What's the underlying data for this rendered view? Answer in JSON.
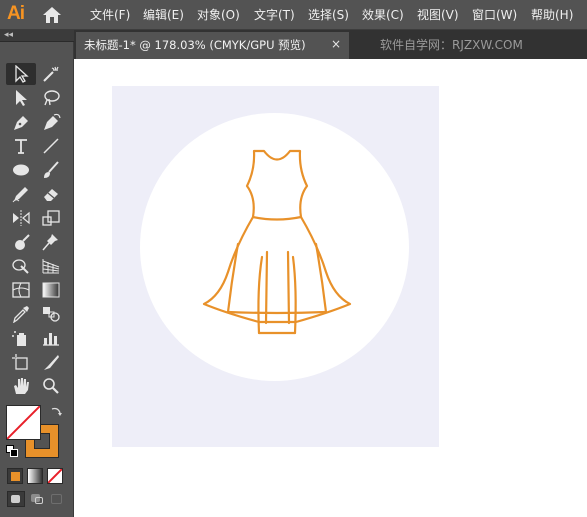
{
  "app": {
    "logo": "Ai",
    "home_icon": "home-icon"
  },
  "menu": {
    "items": [
      "文件(F)",
      "编辑(E)",
      "对象(O)",
      "文字(T)",
      "选择(S)",
      "效果(C)",
      "视图(V)",
      "窗口(W)",
      "帮助(H)"
    ]
  },
  "tabs": {
    "collapse": "◂◂",
    "active_title": "未标题-1* @ 178.03% (CMYK/GPU 预览)",
    "close": "×",
    "watermark": "软件自学网：RJZXW.COM"
  },
  "colors": {
    "accent": "#f79422",
    "dress_stroke": "#e8912a",
    "fill_swatch": "#ffffff",
    "stroke_swatch": "#e8912a",
    "artboard": "#eeeef8",
    "chrome": "#535353"
  },
  "tools": [
    "selection-tool",
    "magic-wand-tool",
    "direct-selection-tool",
    "lasso-tool",
    "pen-tool",
    "curvature-tool",
    "type-tool",
    "line-segment-tool",
    "ellipse-tool",
    "paintbrush-tool",
    "shaper-tool",
    "eraser-tool",
    "reflect-tool",
    "scale-tool",
    "warp-tool",
    "puppet-warp-tool",
    "shape-builder-tool",
    "perspective-grid-tool",
    "mesh-tool",
    "gradient-tool",
    "eyedropper-tool",
    "blend-tool",
    "symbol-sprayer-tool",
    "column-graph-tool",
    "artboard-tool",
    "slice-tool",
    "hand-tool",
    "zoom-tool"
  ]
}
